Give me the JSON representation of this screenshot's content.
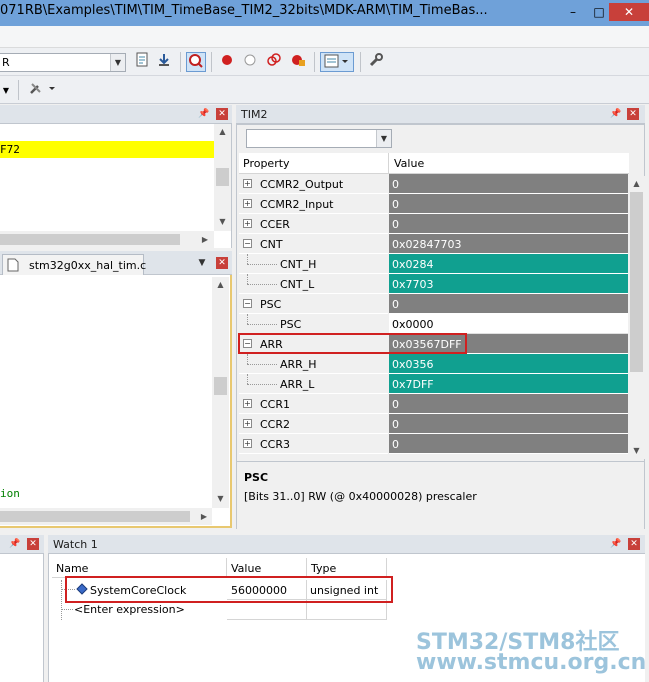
{
  "window": {
    "title": "071RB\\Examples\\TIM\\TIM_TimeBase_TIM2_32bits\\MDK-ARM\\TIM_TimeBas...",
    "minimize": "–",
    "maximize": "□",
    "close": "✕"
  },
  "toolbar": {
    "target_value": "R",
    "icons": [
      "doc-icon",
      "download-icon",
      "debug-icon",
      "breakpoint-icon",
      "breakpoint-empty-icon",
      "breakpoint-link-icon",
      "breakpoint-kill-icon",
      "window-layout-icon",
      "wrench-icon"
    ]
  },
  "left_top_panel": {
    "highlight_text": "F72"
  },
  "editor": {
    "tab_label": "stm32g0xx_hal_tim.c",
    "visible_text": "ion"
  },
  "tim2": {
    "title": "TIM2",
    "header_property": "Property",
    "header_value": "Value",
    "rows": [
      {
        "name": "CCMR2_Output",
        "value": "0",
        "level": 0,
        "exp": "+",
        "style": "gray"
      },
      {
        "name": "CCMR2_Input",
        "value": "0",
        "level": 0,
        "exp": "+",
        "style": "gray"
      },
      {
        "name": "CCER",
        "value": "0",
        "level": 0,
        "exp": "+",
        "style": "gray"
      },
      {
        "name": "CNT",
        "value": "0x02847703",
        "level": 0,
        "exp": "−",
        "style": "gray"
      },
      {
        "name": "CNT_H",
        "value": "0x0284",
        "level": 1,
        "exp": "",
        "style": "teal"
      },
      {
        "name": "CNT_L",
        "value": "0x7703",
        "level": 1,
        "exp": "",
        "style": "teal"
      },
      {
        "name": "PSC",
        "value": "0",
        "level": 0,
        "exp": "−",
        "style": "gray"
      },
      {
        "name": "PSC",
        "value": "0x0000",
        "level": 1,
        "exp": "",
        "style": "white"
      },
      {
        "name": "ARR",
        "value": "0x03567DFF",
        "level": 0,
        "exp": "−",
        "style": "gray"
      },
      {
        "name": "ARR_H",
        "value": "0x0356",
        "level": 1,
        "exp": "",
        "style": "teal"
      },
      {
        "name": "ARR_L",
        "value": "0x7DFF",
        "level": 1,
        "exp": "",
        "style": "teal"
      },
      {
        "name": "CCR1",
        "value": "0",
        "level": 0,
        "exp": "+",
        "style": "gray"
      },
      {
        "name": "CCR2",
        "value": "0",
        "level": 0,
        "exp": "+",
        "style": "gray"
      },
      {
        "name": "CCR3",
        "value": "0",
        "level": 0,
        "exp": "+",
        "style": "gray"
      }
    ],
    "desc_title": "PSC",
    "desc_text": "[Bits 31..0] RW (@ 0x40000028) prescaler"
  },
  "watch": {
    "title": "Watch 1",
    "col_name": "Name",
    "col_value": "Value",
    "col_type": "Type",
    "var_name": "SystemCoreClock",
    "var_value": "56000000",
    "var_type": "unsigned int",
    "enter_expr": "<Enter expression>"
  },
  "watermark": {
    "line1": "STM32/STM8社区",
    "line2": "www.stmcu.org.cn"
  },
  "colors": {
    "gray_cell": "#808080",
    "teal_cell": "#10a090",
    "highlight_yellow": "#ffff00",
    "red_box": "#d02020",
    "watermark": "#9cc4dc"
  }
}
